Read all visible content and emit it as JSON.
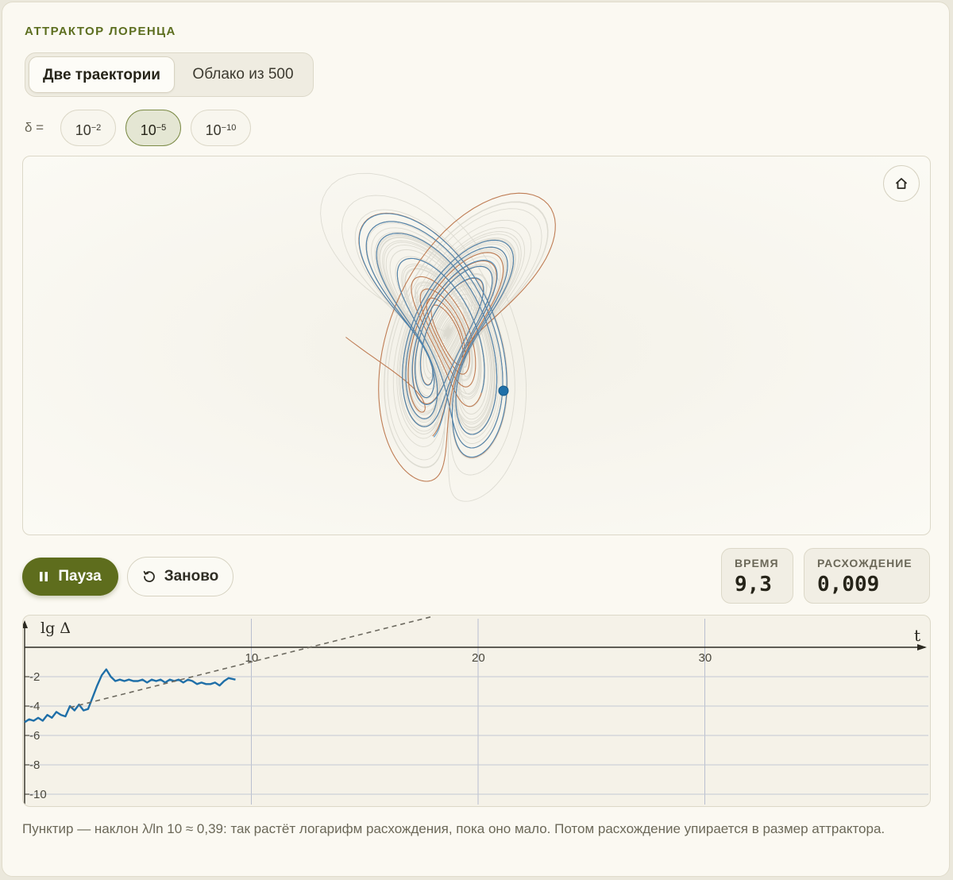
{
  "header": {
    "title": "АТТРАКТОР ЛОРЕНЦА"
  },
  "mode_tabs": [
    {
      "label": "Две траектории",
      "selected": true
    },
    {
      "label": "Облако из 500",
      "selected": false
    }
  ],
  "delta": {
    "label": "δ =",
    "options": [
      {
        "base": "10",
        "exp": "−2",
        "selected": false
      },
      {
        "base": "10",
        "exp": "−5",
        "selected": true
      },
      {
        "base": "10",
        "exp": "−10",
        "selected": false
      }
    ]
  },
  "attractor": {
    "home_icon": "home-icon",
    "colors": {
      "a": "#b5673a",
      "b": "#3a86c0",
      "cloud": "#c9c6bc"
    }
  },
  "controls": {
    "pause_label": "Пауза",
    "restart_label": "Заново"
  },
  "stats": {
    "time_label": "ВРЕМЯ",
    "time_value": "9,3",
    "divergence_label": "РАСХОЖДЕНИЕ",
    "divergence_value": "0,009"
  },
  "chart_data": {
    "type": "line",
    "ylabel": "lg Δ",
    "xlabel": "t",
    "x_ticks": [
      "10",
      "20",
      "30"
    ],
    "y_ticks": [
      "-2",
      "-4",
      "-6",
      "-8",
      "-10"
    ],
    "xlim": [
      0,
      40
    ],
    "ylim": [
      -11,
      0
    ],
    "grid": true,
    "series": [
      {
        "color": "#1f6fa8",
        "x": [
          0,
          0.2,
          0.4,
          0.6,
          0.8,
          1.0,
          1.2,
          1.4,
          1.6,
          1.8,
          2.0,
          2.2,
          2.4,
          2.6,
          2.8,
          3.0,
          3.2,
          3.4,
          3.6,
          3.8,
          4.0,
          4.2,
          4.4,
          4.6,
          4.8,
          5.0,
          5.2,
          5.4,
          5.6,
          5.8,
          6.0,
          6.2,
          6.4,
          6.6,
          6.8,
          7.0,
          7.2,
          7.4,
          7.6,
          7.8,
          8.0,
          8.2,
          8.4,
          8.6,
          8.8,
          9.0,
          9.3
        ],
        "y": [
          -5.1,
          -4.9,
          -5.0,
          -4.8,
          -5.0,
          -4.6,
          -4.8,
          -4.4,
          -4.6,
          -4.7,
          -4.0,
          -4.3,
          -3.9,
          -4.3,
          -4.2,
          -3.4,
          -2.6,
          -1.9,
          -1.5,
          -2.0,
          -2.3,
          -2.2,
          -2.3,
          -2.2,
          -2.3,
          -2.3,
          -2.2,
          -2.4,
          -2.2,
          -2.3,
          -2.2,
          -2.4,
          -2.2,
          -2.3,
          -2.2,
          -2.4,
          -2.2,
          -2.3,
          -2.5,
          -2.4,
          -2.5,
          -2.5,
          -2.4,
          -2.6,
          -2.3,
          -2.1,
          -2.2
        ]
      },
      {
        "color": "#6d6a60",
        "style": "dashed",
        "x": [
          2,
          18
        ],
        "y": [
          -4.1,
          2.1
        ]
      }
    ]
  },
  "caption": "Пунктир — наклон λ/ln 10 ≈ 0,39: так растёт логарифм расхождения, пока оно мало. Потом расхождение упирается в размер аттрактора."
}
